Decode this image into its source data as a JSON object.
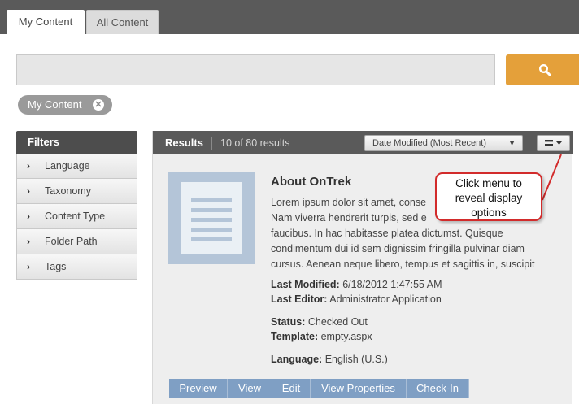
{
  "tabs": [
    {
      "label": "My Content",
      "active": true
    },
    {
      "label": "All Content",
      "active": false
    }
  ],
  "search": {
    "placeholder": "",
    "button_icon": "search-icon"
  },
  "active_filter_chip": {
    "label": "My Content",
    "close_icon": "close-icon"
  },
  "filters": {
    "title": "Filters",
    "items": [
      {
        "label": "Language"
      },
      {
        "label": "Taxonomy"
      },
      {
        "label": "Content Type"
      },
      {
        "label": "Folder Path"
      },
      {
        "label": "Tags"
      }
    ]
  },
  "results": {
    "title": "Results",
    "count_text": "10 of 80 results",
    "sort_selected": "Date Modified (Most Recent)",
    "display_menu_icon": "list-view-icon"
  },
  "item": {
    "title": "About OnTrek",
    "description_lines": [
      "Lorem ipsum dolor sit amet, conse",
      "Nam viverra hendrerit turpis, sed e",
      "faucibus. In hac habitasse platea dictumst. Quisque",
      "condimentum dui id sem dignissim fringilla pulvinar diam",
      "cursus. Aenean neque libero, tempus et sagittis in, suscipit"
    ],
    "last_modified_label": "Last Modified:",
    "last_modified_value": "6/18/2012 1:47:55 AM",
    "last_editor_label": "Last Editor:",
    "last_editor_value": "Administrator Application",
    "status_label": "Status:",
    "status_value": "Checked Out",
    "template_label": "Template:",
    "template_value": "empty.aspx",
    "language_label": "Language:",
    "language_value": "English (U.S.)"
  },
  "actions": [
    {
      "label": "Preview"
    },
    {
      "label": "View"
    },
    {
      "label": "Edit"
    },
    {
      "label": "View Properties"
    },
    {
      "label": "Check-In"
    }
  ],
  "callout": {
    "line1": "Click menu to",
    "line2": "reveal display",
    "line3": "options"
  },
  "colors": {
    "header_dark": "#5a5a5a",
    "search_button": "#e4a03a",
    "action_button": "#7f9fc4",
    "callout_border": "#d22b2b",
    "doc_thumb": "#b4c5d8"
  }
}
